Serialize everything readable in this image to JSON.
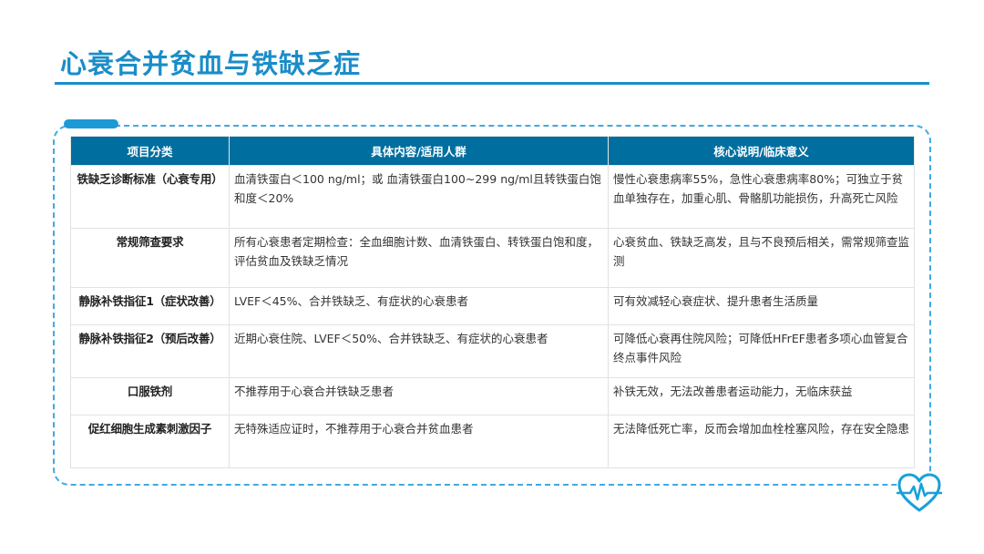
{
  "slide": {
    "title": "心衰合并贫血与铁缺乏症"
  },
  "table": {
    "headers": [
      "项目分类",
      "具体内容/适用人群",
      "核心说明/临床意义"
    ],
    "rows": [
      {
        "category": "铁缺乏诊断标准（心衰专用）",
        "content": "血清铁蛋白＜100 ng/ml；或 血清铁蛋白100~299 ng/ml且转铁蛋白饱和度＜20%",
        "meaning": "慢性心衰患病率55%，急性心衰患病率80%；可独立于贫血单独存在，加重心肌、骨骼肌功能损伤，升高死亡风险"
      },
      {
        "category": "常规筛查要求",
        "content": "所有心衰患者定期检查：全血细胞计数、血清铁蛋白、转铁蛋白饱和度，评估贫血及铁缺乏情况",
        "meaning": "心衰贫血、铁缺乏高发，且与不良预后相关，需常规筛查监测"
      },
      {
        "category": "静脉补铁指征1（症状改善）",
        "content": "LVEF＜45%、合并铁缺乏、有症状的心衰患者",
        "meaning": "可有效减轻心衰症状、提升患者生活质量"
      },
      {
        "category": "静脉补铁指征2（预后改善）",
        "content": "近期心衰住院、LVEF＜50%、合并铁缺乏、有症状的心衰患者",
        "meaning": "可降低心衰再住院风险；可降低HFrEF患者多项心血管复合终点事件风险"
      },
      {
        "category": "口服铁剂",
        "content": "不推荐用于心衰合并铁缺乏患者",
        "meaning": "补铁无效，无法改善患者运动能力，无临床获益"
      },
      {
        "category": "促红细胞生成素刺激因子",
        "content": "无特殊适应证时，不推荐用于心衰合并贫血患者",
        "meaning": "无法降低死亡率，反而会增加血栓栓塞风险，存在安全隐患"
      }
    ]
  },
  "icons": {
    "corner": "heart-pulse-icon"
  },
  "colors": {
    "accent": "#1a8dc8",
    "header_bg": "#006e9f",
    "frame": "#41a9e0"
  }
}
